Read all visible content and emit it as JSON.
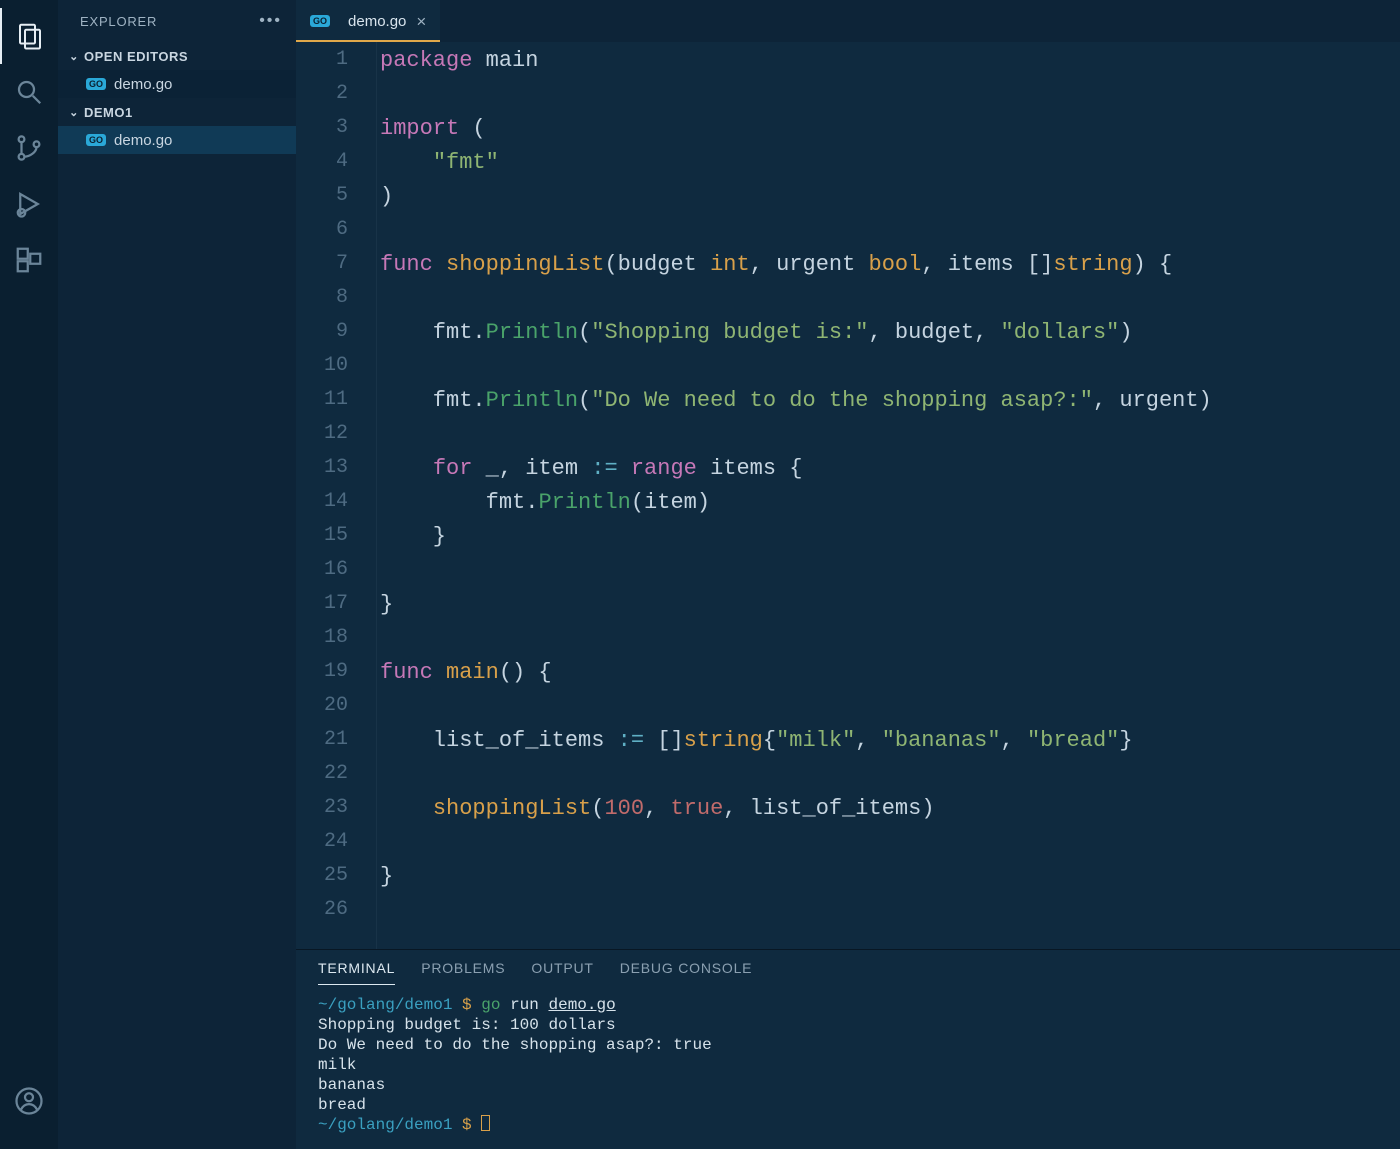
{
  "sidebar": {
    "title": "EXPLORER",
    "sections": {
      "openEditors": {
        "label": "OPEN EDITORS",
        "items": [
          {
            "label": "demo.go",
            "lang": "GO"
          }
        ]
      },
      "project": {
        "label": "DEMO1",
        "items": [
          {
            "label": "demo.go",
            "lang": "GO"
          }
        ]
      }
    }
  },
  "tabs": [
    {
      "label": "demo.go",
      "lang": "GO",
      "active": true
    }
  ],
  "code": {
    "lines": [
      [
        [
          "kw",
          "package"
        ],
        [
          "punc",
          " "
        ],
        [
          "id",
          "main"
        ]
      ],
      [
        [
          "punc",
          ""
        ]
      ],
      [
        [
          "kw",
          "import"
        ],
        [
          "punc",
          " ("
        ]
      ],
      [
        [
          "punc",
          "    "
        ],
        [
          "str",
          "\"fmt\""
        ]
      ],
      [
        [
          "punc",
          ")"
        ]
      ],
      [
        [
          "punc",
          ""
        ]
      ],
      [
        [
          "kw",
          "func"
        ],
        [
          "punc",
          " "
        ],
        [
          "func",
          "shoppingList"
        ],
        [
          "punc",
          "(budget "
        ],
        [
          "type",
          "int"
        ],
        [
          "punc",
          ", urgent "
        ],
        [
          "type",
          "bool"
        ],
        [
          "punc",
          ", items []"
        ],
        [
          "type",
          "string"
        ],
        [
          "punc",
          ") {"
        ]
      ],
      [
        [
          "punc",
          ""
        ]
      ],
      [
        [
          "punc",
          "    fmt."
        ],
        [
          "call",
          "Println"
        ],
        [
          "punc",
          "("
        ],
        [
          "str",
          "\"Shopping budget is:\""
        ],
        [
          "punc",
          ", budget, "
        ],
        [
          "str",
          "\"dollars\""
        ],
        [
          "punc",
          ")"
        ]
      ],
      [
        [
          "punc",
          ""
        ]
      ],
      [
        [
          "punc",
          "    fmt."
        ],
        [
          "call",
          "Println"
        ],
        [
          "punc",
          "("
        ],
        [
          "str",
          "\"Do We need to do the shopping asap?:\""
        ],
        [
          "punc",
          ", urgent)"
        ]
      ],
      [
        [
          "punc",
          ""
        ]
      ],
      [
        [
          "punc",
          "    "
        ],
        [
          "kw",
          "for"
        ],
        [
          "punc",
          " _, item "
        ],
        [
          "op",
          ":="
        ],
        [
          "punc",
          " "
        ],
        [
          "kw",
          "range"
        ],
        [
          "punc",
          " items {"
        ]
      ],
      [
        [
          "punc",
          "        fmt."
        ],
        [
          "call",
          "Println"
        ],
        [
          "punc",
          "(item)"
        ]
      ],
      [
        [
          "punc",
          "    }"
        ]
      ],
      [
        [
          "punc",
          ""
        ]
      ],
      [
        [
          "punc",
          "}"
        ]
      ],
      [
        [
          "punc",
          ""
        ]
      ],
      [
        [
          "kw",
          "func"
        ],
        [
          "punc",
          " "
        ],
        [
          "func",
          "main"
        ],
        [
          "punc",
          "() {"
        ]
      ],
      [
        [
          "punc",
          ""
        ]
      ],
      [
        [
          "punc",
          "    list_of_items "
        ],
        [
          "op",
          ":="
        ],
        [
          "punc",
          " []"
        ],
        [
          "type",
          "string"
        ],
        [
          "punc",
          "{"
        ],
        [
          "str",
          "\"milk\""
        ],
        [
          "punc",
          ", "
        ],
        [
          "str",
          "\"bananas\""
        ],
        [
          "punc",
          ", "
        ],
        [
          "str",
          "\"bread\""
        ],
        [
          "punc",
          "}"
        ]
      ],
      [
        [
          "punc",
          ""
        ]
      ],
      [
        [
          "punc",
          "    "
        ],
        [
          "func",
          "shoppingList"
        ],
        [
          "punc",
          "("
        ],
        [
          "num",
          "100"
        ],
        [
          "punc",
          ", "
        ],
        [
          "bool",
          "true"
        ],
        [
          "punc",
          ", list_of_items)"
        ]
      ],
      [
        [
          "punc",
          ""
        ]
      ],
      [
        [
          "punc",
          "}"
        ]
      ],
      [
        [
          "punc",
          ""
        ]
      ]
    ]
  },
  "panel": {
    "tabs": [
      "TERMINAL",
      "PROBLEMS",
      "OUTPUT",
      "DEBUG CONSOLE"
    ],
    "activeTab": 0,
    "terminal": {
      "prompt": {
        "path": "~/golang/demo1",
        "dollar": "$"
      },
      "cmd": {
        "bin": "go",
        "rest": "run",
        "file": "demo.go"
      },
      "output": [
        "Shopping budget is: 100 dollars",
        "Do We need to do the shopping asap?: true",
        "milk",
        "bananas",
        "bread"
      ]
    }
  },
  "icons": {
    "explorer": "explorer",
    "search": "search",
    "scm": "scm",
    "debug": "debug",
    "extensions": "extensions",
    "account": "account"
  }
}
